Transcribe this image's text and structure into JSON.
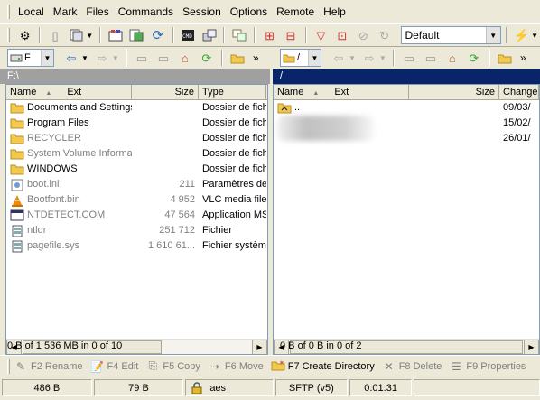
{
  "menu": [
    "Local",
    "Mark",
    "Files",
    "Commands",
    "Session",
    "Options",
    "Remote",
    "Help"
  ],
  "toolbar": {
    "profile_value": "Default"
  },
  "left_pane": {
    "drive": "F",
    "path": "F:\\",
    "columns": {
      "name": "Name",
      "ext": "Ext",
      "size": "Size",
      "type": "Type"
    },
    "rows": [
      {
        "name": "Documents and Settings",
        "size": "",
        "type": "Dossier de fichiers",
        "icon": "folder-icon",
        "dim": false
      },
      {
        "name": "Program Files",
        "size": "",
        "type": "Dossier de fichiers",
        "icon": "folder-icon",
        "dim": false
      },
      {
        "name": "RECYCLER",
        "size": "",
        "type": "Dossier de fichiers",
        "icon": "folder-icon",
        "dim": true
      },
      {
        "name": "System Volume Informa...",
        "size": "",
        "type": "Dossier de fichiers",
        "icon": "folder-icon",
        "dim": true
      },
      {
        "name": "WINDOWS",
        "size": "",
        "type": "Dossier de fichiers",
        "icon": "folder-icon",
        "dim": false
      },
      {
        "name": "boot.ini",
        "size": "211",
        "type": "Paramètres de configuration",
        "icon": "settings-file-icon",
        "dim": true
      },
      {
        "name": "Bootfont.bin",
        "size": "4 952",
        "type": "VLC media file",
        "icon": "vlc-cone-icon",
        "dim": true
      },
      {
        "name": "NTDETECT.COM",
        "size": "47 564",
        "type": "Application MS-DOS",
        "icon": "application-icon",
        "dim": true
      },
      {
        "name": "ntldr",
        "size": "251 712",
        "type": "Fichier",
        "icon": "file-icon",
        "dim": true
      },
      {
        "name": "pagefile.sys",
        "size": "1 610 61...",
        "type": "Fichier système",
        "icon": "file-icon",
        "dim": true
      }
    ],
    "status": "0 B of 1 536 MB in 0 of 10"
  },
  "right_pane": {
    "path": "/",
    "columns": {
      "name": "Name",
      "ext": "Ext",
      "size": "Size",
      "changed": "Changed"
    },
    "rows": [
      {
        "name": "..",
        "changed": "09/03/",
        "icon": "parent-folder-icon"
      },
      {
        "name": "",
        "changed": "15/02/",
        "icon": ""
      },
      {
        "name": "",
        "changed": "26/01/",
        "icon": ""
      }
    ],
    "status": "0 B of 0 B in 0 of 2"
  },
  "function_keys": [
    {
      "label": "F2 Rename",
      "icon": "rename-icon",
      "active": false
    },
    {
      "label": "F4 Edit",
      "icon": "edit-icon",
      "active": false
    },
    {
      "label": "F5 Copy",
      "icon": "copy-icon",
      "active": false
    },
    {
      "label": "F6 Move",
      "icon": "move-icon",
      "active": false
    },
    {
      "label": "F7 Create Directory",
      "icon": "new-folder-icon",
      "active": true
    },
    {
      "label": "F8 Delete",
      "icon": "delete-icon",
      "active": false
    },
    {
      "label": "F9 Properties",
      "icon": "properties-icon",
      "active": false
    }
  ],
  "statusbar": {
    "bytes_sent": "486 B",
    "bytes_received": "79 B",
    "cipher": "aes",
    "protocol": "SFTP (v5)",
    "elapsed": "0:01:31"
  }
}
